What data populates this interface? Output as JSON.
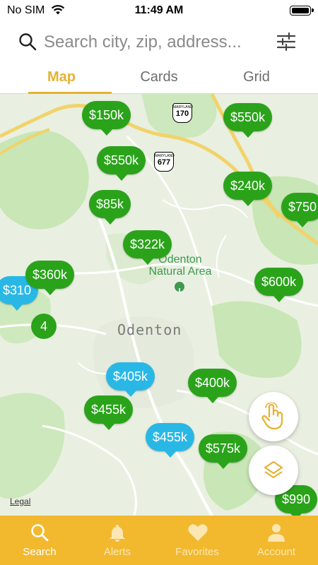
{
  "status": {
    "carrier": "No SIM",
    "time": "11:49 AM",
    "battery_level": 0.95
  },
  "search": {
    "placeholder": "Search city, zip, address..."
  },
  "tabs": [
    {
      "label": "Map"
    },
    {
      "label": "Cards"
    },
    {
      "label": "Grid"
    }
  ],
  "map": {
    "place_label": "Odenton",
    "area_label": "Odenton Natural Area",
    "legal": "Legal",
    "road_signs": [
      {
        "state": "MARYLAND",
        "number": "170"
      },
      {
        "state": "MARYLAND",
        "number": "677"
      }
    ],
    "pins": [
      {
        "price": "$150k",
        "color": "green"
      },
      {
        "price": "$550k",
        "color": "green"
      },
      {
        "price": "$550k",
        "color": "green"
      },
      {
        "price": "$85k",
        "color": "green"
      },
      {
        "price": "$240k",
        "color": "green"
      },
      {
        "price": "$750",
        "color": "green"
      },
      {
        "price": "$322k",
        "color": "green"
      },
      {
        "price": "$310",
        "color": "blue"
      },
      {
        "price": "$360k",
        "color": "green"
      },
      {
        "price": "$600k",
        "color": "green"
      },
      {
        "price": "$405k",
        "color": "blue"
      },
      {
        "price": "$400k",
        "color": "green"
      },
      {
        "price": "$455k",
        "color": "green"
      },
      {
        "price": "$455k",
        "color": "blue"
      },
      {
        "price": "$575k",
        "color": "green"
      },
      {
        "price": "$990",
        "color": "green"
      }
    ],
    "cluster": {
      "count": "4"
    }
  },
  "bottom_nav": [
    {
      "label": "Search",
      "icon": "search-icon",
      "active": true
    },
    {
      "label": "Alerts",
      "icon": "bell-icon",
      "active": false
    },
    {
      "label": "Favorites",
      "icon": "heart-icon",
      "active": false
    },
    {
      "label": "Account",
      "icon": "person-icon",
      "active": false
    }
  ],
  "colors": {
    "accent": "#e6b233",
    "pin_green": "#2aa31a",
    "pin_blue": "#29b8e6",
    "tabbar": "#f2b92e"
  }
}
